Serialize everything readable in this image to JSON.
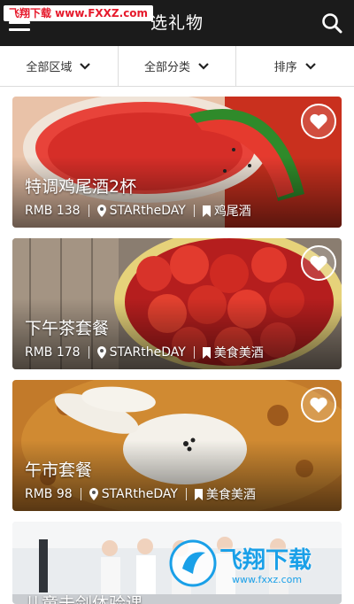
{
  "watermark": "飞翔下载 www.FXXZ.com",
  "app": {
    "title": "选礼物"
  },
  "filters": [
    {
      "label": "全部区域"
    },
    {
      "label": "全部分类"
    },
    {
      "label": "排序"
    }
  ],
  "cards": [
    {
      "title": "特调鸡尾酒2杯",
      "price": "RMB 138",
      "venue": "STARtheDAY",
      "category": "鸡尾酒",
      "image": "watermelon-cocktail-photo"
    },
    {
      "title": "下午茶套餐",
      "price": "RMB 178",
      "venue": "STARtheDAY",
      "category": "美食美酒",
      "image": "strawberry-dessert-photo"
    },
    {
      "title": "午市套餐",
      "price": "RMB 98",
      "venue": "STARtheDAY",
      "category": "美食美酒",
      "image": "bunny-rice-curry-photo"
    },
    {
      "title": "儿童击剑体验课",
      "image": "kids-fencing-photo"
    }
  ],
  "site_mark": {
    "title": "飞翔下载",
    "url": "www.fxxz.com"
  },
  "colors": {
    "appbar": "#1b1b1b",
    "accent": "#1aa0e8"
  }
}
